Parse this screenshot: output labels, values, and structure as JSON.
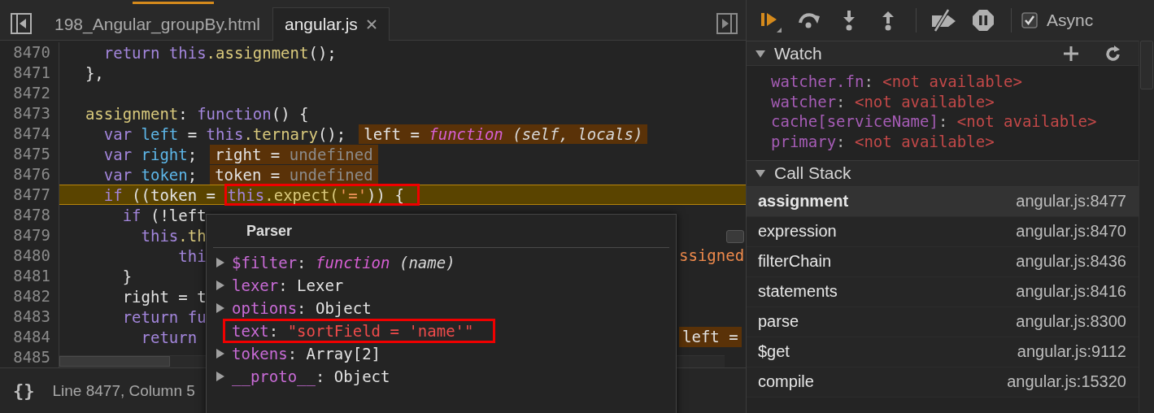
{
  "editor": {
    "tabs": [
      {
        "label": "198_Angular_groupBy.html",
        "selected": false,
        "closable": false
      },
      {
        "label": "angular.js",
        "selected": true,
        "closable": true
      }
    ],
    "lines": [
      {
        "number": "8470",
        "current": false,
        "segments": [
          {
            "text": "    return this",
            "kind": "kw"
          },
          {
            "text": ".assignment",
            "kind": "prop"
          },
          {
            "text": "();",
            "kind": "plain"
          }
        ]
      },
      {
        "number": "8471",
        "current": false,
        "segments": [
          {
            "text": "  },",
            "kind": "plain"
          }
        ]
      },
      {
        "number": "8472",
        "current": false
      },
      {
        "number": "8473",
        "current": false,
        "segments": [
          {
            "text": "  assignment",
            "kind": "prop"
          },
          {
            "text": ": ",
            "kind": "plain"
          },
          {
            "text": "function",
            "kind": "kw"
          },
          {
            "text": "() {",
            "kind": "plain"
          }
        ]
      },
      {
        "number": "8474",
        "current": false,
        "segments": [
          {
            "text": "    var ",
            "kind": "kw"
          },
          {
            "text": "left",
            "kind": "var"
          },
          {
            "text": " = ",
            "kind": "plain"
          },
          {
            "text": "this",
            "kind": "kw"
          },
          {
            "text": ".ternary",
            "kind": "prop"
          },
          {
            "text": "();",
            "kind": "plain"
          }
        ],
        "inline_value": [
          {
            "text": "left = ",
            "kind": "plain"
          },
          {
            "text": "function",
            "kind": "fn"
          },
          {
            "text": " (self, locals)",
            "kind": "italic"
          }
        ]
      },
      {
        "number": "8475",
        "current": false,
        "segments": [
          {
            "text": "    var ",
            "kind": "kw"
          },
          {
            "text": "right",
            "kind": "var"
          },
          {
            "text": ";",
            "kind": "plain"
          }
        ],
        "inline_value": [
          {
            "text": "right = ",
            "kind": "plain"
          },
          {
            "text": "undefined",
            "kind": "undef"
          }
        ]
      },
      {
        "number": "8476",
        "current": false,
        "segments": [
          {
            "text": "    var ",
            "kind": "kw"
          },
          {
            "text": "token",
            "kind": "var"
          },
          {
            "text": ";",
            "kind": "plain"
          }
        ],
        "inline_value": [
          {
            "text": "token = ",
            "kind": "plain"
          },
          {
            "text": "undefined",
            "kind": "undef"
          }
        ]
      },
      {
        "number": "8477",
        "current": true,
        "segments": [
          {
            "text": "    if",
            "kind": "kw"
          },
          {
            "text": " ((token = ",
            "kind": "plain"
          }
        ],
        "boxed_segments": [
          {
            "text": "this",
            "kind": "kw"
          },
          {
            "text": ".expect(",
            "kind": "prop"
          },
          {
            "text": "'='",
            "kind": "str"
          },
          {
            "text": ")) {",
            "kind": "plain"
          }
        ]
      },
      {
        "number": "8478",
        "current": false,
        "segments": [
          {
            "text": "      if",
            "kind": "kw"
          },
          {
            "text": " (!left",
            "kind": "plain"
          }
        ]
      },
      {
        "number": "8479",
        "current": false,
        "segments": [
          {
            "text": "        this",
            "kind": "kw"
          },
          {
            "text": ".th",
            "kind": "prop"
          }
        ]
      },
      {
        "number": "8480",
        "current": false,
        "segments": [
          {
            "text": "            thi",
            "kind": "kw"
          }
        ],
        "far_value": {
          "kind": "note",
          "text": "ssigned"
        }
      },
      {
        "number": "8481",
        "current": false,
        "segments": [
          {
            "text": "      }",
            "kind": "plain"
          }
        ]
      },
      {
        "number": "8482",
        "current": false,
        "segments": [
          {
            "text": "      right = t",
            "kind": "plain"
          }
        ]
      },
      {
        "number": "8483",
        "current": false,
        "segments": [
          {
            "text": "      return fu",
            "kind": "kw"
          }
        ]
      },
      {
        "number": "8484",
        "current": false,
        "segments": [
          {
            "text": "        return",
            "kind": "kw"
          }
        ],
        "far_value": {
          "kind": "badge",
          "text": "left ="
        }
      },
      {
        "number": "8485",
        "current": false
      }
    ],
    "status_bar": {
      "pretty_print": "{}",
      "cursor": "Line 8477, Column 5"
    }
  },
  "popover": {
    "title": "Parser",
    "properties": [
      {
        "key": "$filter",
        "separator": ":",
        "expandable": true,
        "boxed": false,
        "value": [
          {
            "text": "function",
            "kind": "fn"
          },
          {
            "text": " (name)",
            "kind": "italic"
          }
        ]
      },
      {
        "key": "lexer",
        "separator": ":",
        "expandable": true,
        "boxed": false,
        "value": [
          {
            "text": "Lexer",
            "kind": "plain"
          }
        ]
      },
      {
        "key": "options",
        "separator": ":",
        "expandable": true,
        "boxed": false,
        "value": [
          {
            "text": "Object",
            "kind": "plain"
          }
        ]
      },
      {
        "key": "text",
        "separator": ":",
        "expandable": false,
        "boxed": true,
        "value": [
          {
            "text": "\"sortField = 'name'\"",
            "kind": "string"
          }
        ]
      },
      {
        "key": "tokens",
        "separator": ":",
        "expandable": true,
        "boxed": false,
        "value": [
          {
            "text": "Array[2]",
            "kind": "plain"
          }
        ]
      },
      {
        "key": "__proto__",
        "separator": ":",
        "expandable": true,
        "boxed": false,
        "value": [
          {
            "text": "Object",
            "kind": "plain"
          }
        ]
      }
    ]
  },
  "debugger": {
    "async": {
      "label": "Async",
      "checked": true
    },
    "watch": {
      "title": "Watch",
      "expanded": true,
      "expressions": [
        {
          "name": "watcher.fn",
          "separator": ":",
          "value": "<not available>"
        },
        {
          "name": "watcher",
          "separator": ":",
          "value": "<not available>"
        },
        {
          "name": "cache[serviceName]",
          "separator": ":",
          "value": "<not available>"
        },
        {
          "name": "primary",
          "separator": ":",
          "value": "<not available>"
        }
      ]
    },
    "call_stack": {
      "title": "Call Stack",
      "expanded": true,
      "frames": [
        {
          "function": "assignment",
          "location": "angular.js:8477",
          "selected": true
        },
        {
          "function": "expression",
          "location": "angular.js:8470",
          "selected": false
        },
        {
          "function": "filterChain",
          "location": "angular.js:8436",
          "selected": false
        },
        {
          "function": "statements",
          "location": "angular.js:8416",
          "selected": false
        },
        {
          "function": "parse",
          "location": "angular.js:8300",
          "selected": false
        },
        {
          "function": "$get",
          "location": "angular.js:9112",
          "selected": false
        },
        {
          "function": "compile",
          "location": "angular.js:15320",
          "selected": false
        }
      ]
    }
  }
}
